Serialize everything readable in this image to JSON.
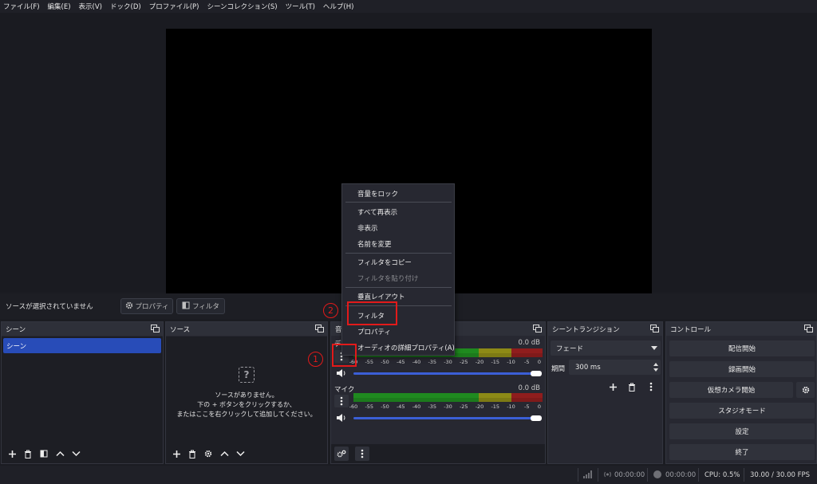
{
  "menu": [
    "ファイル(F)",
    "編集(E)",
    "表示(V)",
    "ドック(D)",
    "プロファイル(P)",
    "シーンコレクション(S)",
    "ツール(T)",
    "ヘルプ(H)"
  ],
  "source_toolbar": {
    "no_source": "ソースが選択されていません",
    "properties": "プロパティ",
    "filters": "フィルタ"
  },
  "docks": {
    "scenes": {
      "title": "シーン",
      "items": [
        "シーン"
      ]
    },
    "sources": {
      "title": "ソース",
      "empty_lines": [
        "ソースがありません。",
        "下の + ボタンをクリックするか、",
        "またはここを右クリックして追加してください。"
      ]
    },
    "audio": {
      "title": "音",
      "tracks": [
        {
          "name": "デ",
          "db": "0.0 dB"
        },
        {
          "name": "マイク",
          "db": "0.0 dB"
        }
      ],
      "scale": [
        "-60",
        "-55",
        "-50",
        "-45",
        "-40",
        "-35",
        "-30",
        "-25",
        "-20",
        "-15",
        "-10",
        "-5",
        "0"
      ],
      "volume": 1.0
    },
    "transitions": {
      "title": "シーントランジション",
      "selected": "フェード",
      "duration_label": "期間",
      "duration": "300 ms"
    },
    "controls": {
      "title": "コントロール",
      "buttons": [
        "配信開始",
        "録画開始",
        "仮想カメラ開始",
        "スタジオモード",
        "設定",
        "終了"
      ]
    }
  },
  "context_menu": {
    "items": [
      {
        "label": "音量をロック",
        "disabled": false
      },
      {
        "label": "すべて再表示",
        "disabled": false
      },
      {
        "label": "非表示",
        "disabled": false
      },
      {
        "label": "名前を変更",
        "disabled": false
      },
      {
        "label": "フィルタをコピー",
        "disabled": false
      },
      {
        "label": "フィルタを貼り付け",
        "disabled": true
      },
      {
        "label": "垂直レイアウト",
        "disabled": false
      },
      {
        "label": "フィルタ",
        "disabled": false
      },
      {
        "label": "プロパティ",
        "disabled": false
      },
      {
        "label": "オーディオの詳細プロパティ(A)",
        "disabled": false
      }
    ]
  },
  "annotations": {
    "step1": "1",
    "step2": "2",
    "color": "#e21a1a"
  },
  "status": {
    "stream_time": "00:00:00",
    "rec_time": "00:00:00",
    "cpu": "CPU: 0.5%",
    "fps": "30.00 / 30.00 FPS"
  },
  "colors": {
    "accent": "#284cb8",
    "slider": "#3b5fd6",
    "meter_green": "#1f8a1f",
    "meter_yellow": "#8d8a16",
    "meter_red": "#8f1d1d"
  }
}
